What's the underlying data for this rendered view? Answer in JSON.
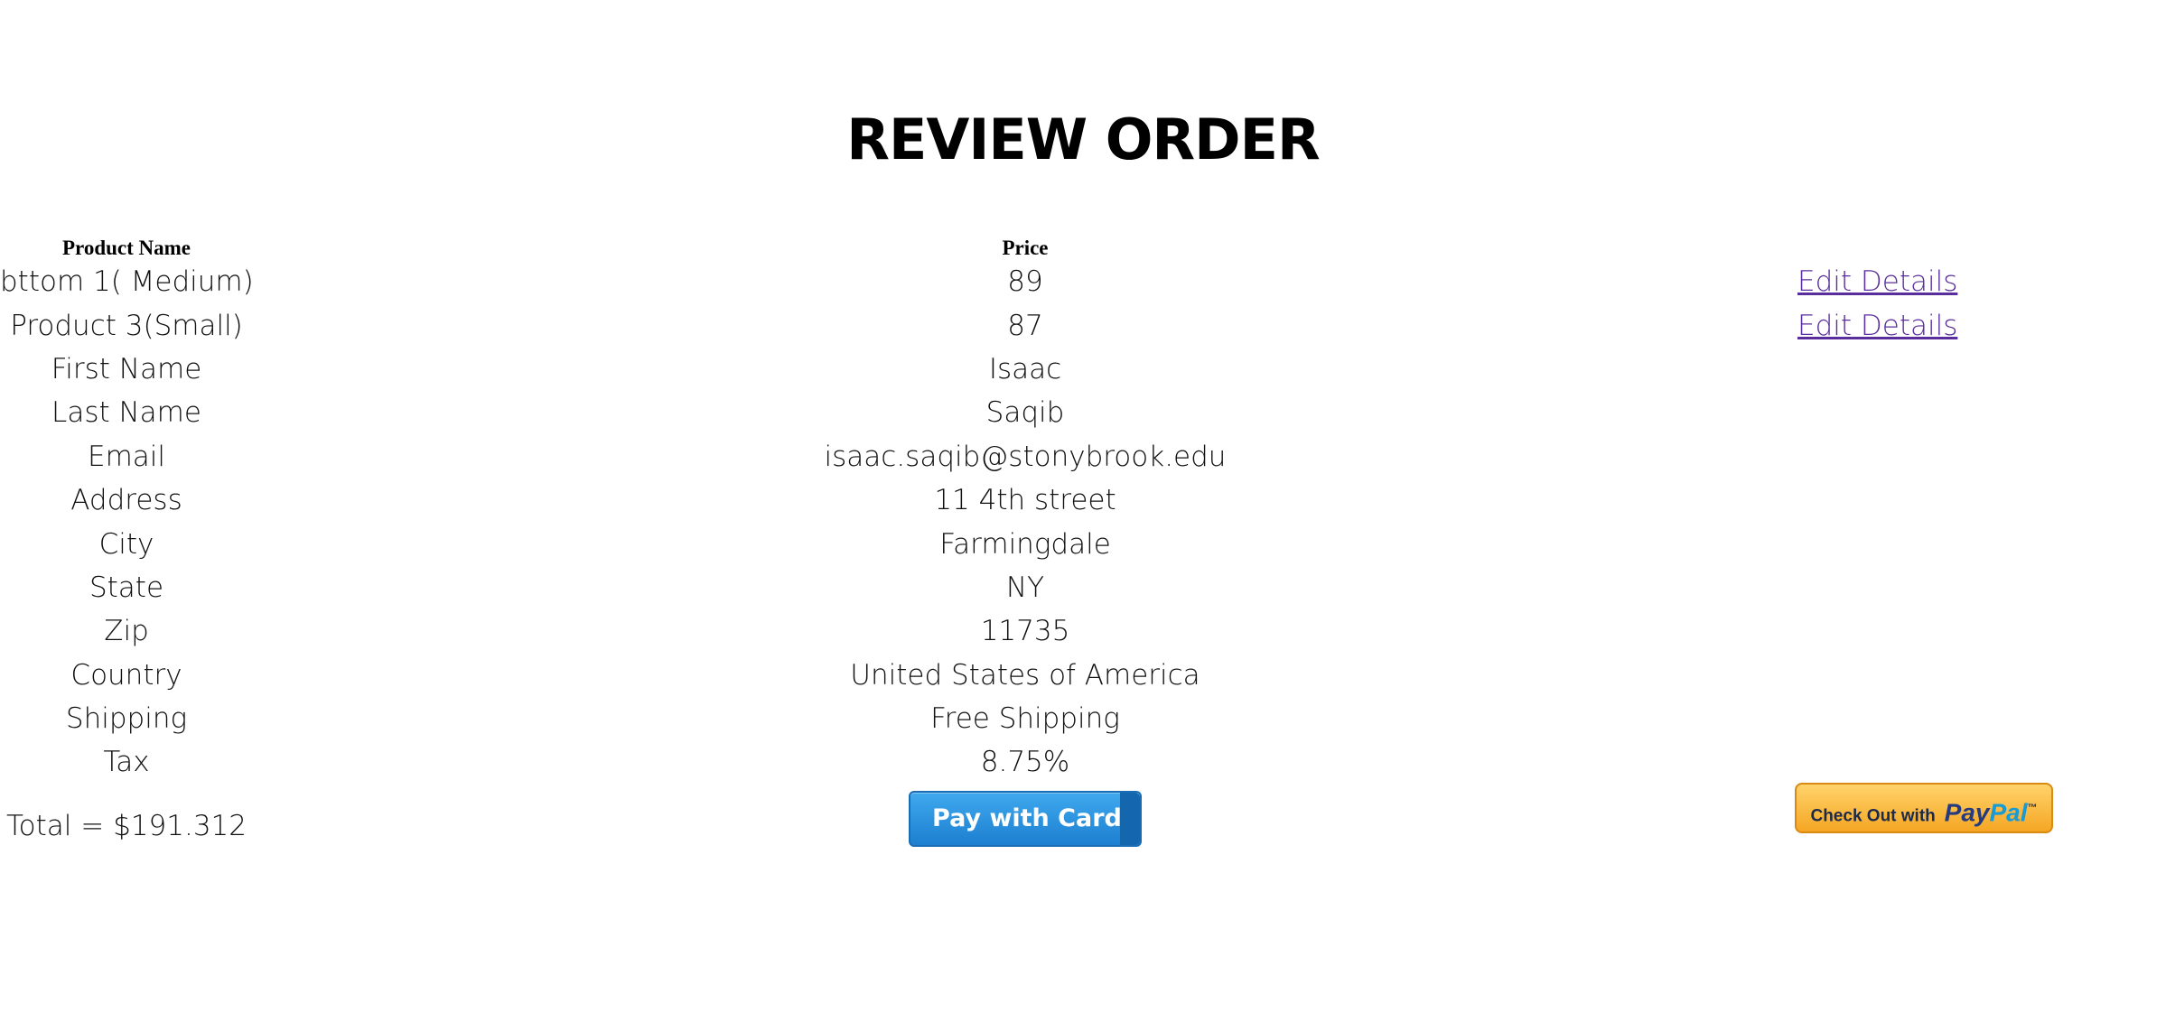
{
  "page": {
    "title": "REVIEW ORDER"
  },
  "table": {
    "headers": [
      "Product Name",
      "Price"
    ],
    "products": [
      {
        "name": "bttom 1( Medium)",
        "price": "89",
        "action": "Edit Details"
      },
      {
        "name": "Product 3(Small)",
        "price": "87",
        "action": "Edit Details"
      }
    ],
    "details": [
      {
        "label": "First Name",
        "value": "Isaac"
      },
      {
        "label": "Last Name",
        "value": "Saqib"
      },
      {
        "label": "Email",
        "value": "isaac.saqib@stonybrook.edu"
      },
      {
        "label": "Address",
        "value": "11 4th street"
      },
      {
        "label": "City",
        "value": "Farmingdale"
      },
      {
        "label": "State",
        "value": "NY"
      },
      {
        "label": "Zip",
        "value": "11735"
      },
      {
        "label": "Country",
        "value": "United States of America"
      },
      {
        "label": "Shipping",
        "value": "Free Shipping"
      },
      {
        "label": "Tax",
        "value": "8.75%"
      }
    ]
  },
  "footer": {
    "total": "Total = $191.312",
    "pay_card_label": "Pay with Card",
    "paypal_prefix": "Check Out with",
    "paypal_brand_1": "Pay",
    "paypal_brand_2": "Pal",
    "paypal_tm": "™"
  },
  "colors": {
    "link": "#5a2d9c",
    "pay_card": "#1d7fd0",
    "paypal_button": "#f5a623"
  }
}
